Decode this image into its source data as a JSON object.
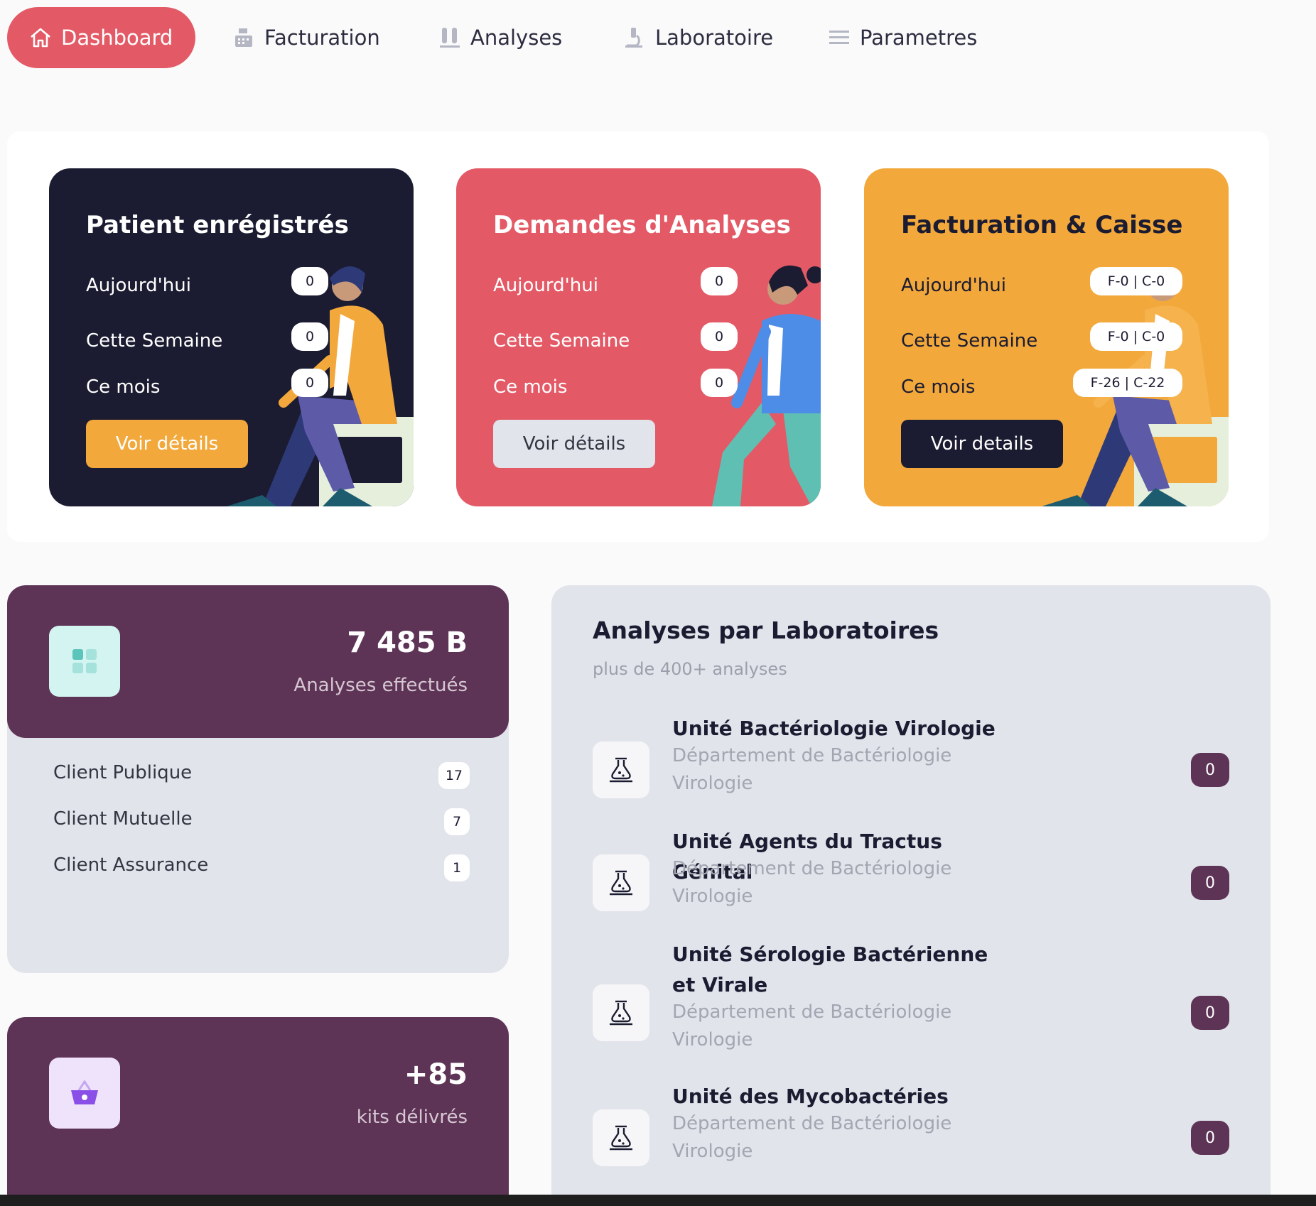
{
  "nav": {
    "items": [
      {
        "label": "Dashboard",
        "icon": "home-icon",
        "active": true
      },
      {
        "label": "Facturation",
        "icon": "cash-register-icon"
      },
      {
        "label": "Analyses",
        "icon": "test-tubes-icon"
      },
      {
        "label": "Laboratoire",
        "icon": "microscope-icon"
      },
      {
        "label": "Parametres",
        "icon": "menu-icon"
      }
    ],
    "active_color": "#e35a66"
  },
  "cards": [
    {
      "title": "Patient enrégistrés",
      "rows": [
        {
          "label": "Aujourd'hui",
          "value": "0"
        },
        {
          "label": "Cette Semaine",
          "value": "0"
        },
        {
          "label": "Ce mois",
          "value": "0"
        }
      ],
      "button": "Voir détails",
      "color": "#1b1c31"
    },
    {
      "title": "Demandes d'Analyses",
      "rows": [
        {
          "label": "Aujourd'hui",
          "value": "0"
        },
        {
          "label": "Cette Semaine",
          "value": "0"
        },
        {
          "label": "Ce mois",
          "value": "0"
        }
      ],
      "button": "Voir détails",
      "color": "#e35a66"
    },
    {
      "title": "Facturation & Caisse",
      "rows": [
        {
          "label": "Aujourd'hui",
          "value": "F-0 | C-0"
        },
        {
          "label": "Cette Semaine",
          "value": "F-0 | C-0"
        },
        {
          "label": "Ce mois",
          "value": "F-26 | C-22"
        }
      ],
      "button": "Voir details",
      "color": "#f2a83b"
    }
  ],
  "stats": {
    "value": "7 485 B",
    "label": "Analyses effectués",
    "icon": "grid-icon",
    "clients": [
      {
        "label": "Client Publique",
        "count": "17"
      },
      {
        "label": "Client Mutuelle",
        "count": "7"
      },
      {
        "label": "Client Assurance",
        "count": "1"
      }
    ]
  },
  "kits": {
    "value": "+85",
    "label": "kits délivrés",
    "icon": "basket-icon"
  },
  "labs": {
    "title": "Analyses par Laboratoires",
    "subtitle": "plus de 400+ analyses",
    "items": [
      {
        "name": "Unité Bactériologie Virologie",
        "dept": "Département de Bactériologie Virologie",
        "count": "0",
        "icon": "lab-flask-icon"
      },
      {
        "name": "Unité Agents du Tractus Génital",
        "dept": "Département de Bactériologie Virologie",
        "count": "0",
        "icon": "lab-flask-icon"
      },
      {
        "name": "Unité Sérologie Bactérienne et Virale",
        "dept": "Département de Bactériologie Virologie",
        "count": "0",
        "icon": "lab-flask-icon"
      },
      {
        "name": "Unité des Mycobactéries",
        "dept": "Département de Bactériologie Virologie",
        "count": "0",
        "icon": "lab-flask-icon"
      }
    ]
  },
  "colors": {
    "accent_purple": "#5e3456",
    "panel_gray": "#e2e4eb"
  }
}
